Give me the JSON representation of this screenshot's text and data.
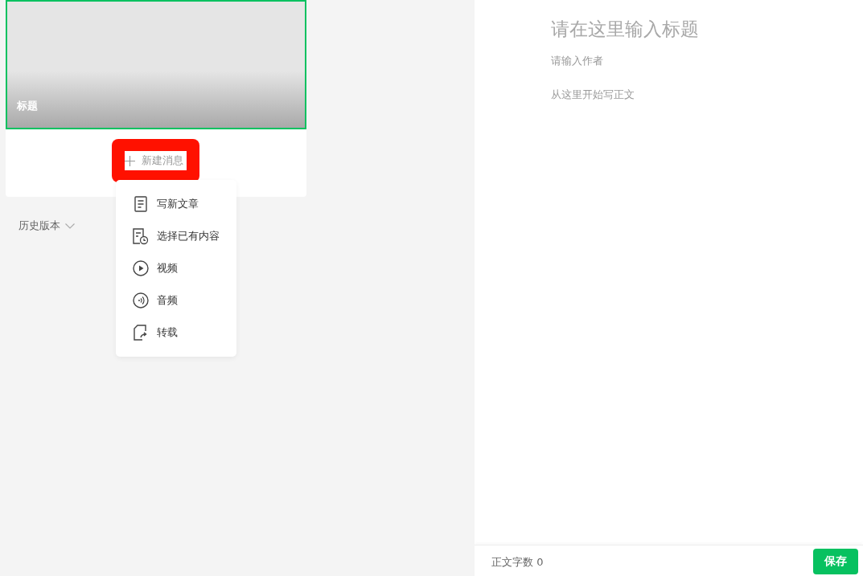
{
  "cover": {
    "title": "标题",
    "selected": true
  },
  "new_button": {
    "label": "新建消息",
    "highlighted": true
  },
  "menu": [
    {
      "kind": "article",
      "label": "写新文章"
    },
    {
      "kind": "existing",
      "label": "选择已有内容"
    },
    {
      "kind": "video",
      "label": "视频"
    },
    {
      "kind": "audio",
      "label": "音频"
    },
    {
      "kind": "repost",
      "label": "转载"
    }
  ],
  "history": {
    "label": "历史版本"
  },
  "editor": {
    "title_placeholder": "请在这里输入标题",
    "author_placeholder": "请输入作者",
    "body_placeholder": "从这里开始写正文"
  },
  "footer": {
    "word_count": "正文字数 0",
    "save_button": "保存"
  }
}
